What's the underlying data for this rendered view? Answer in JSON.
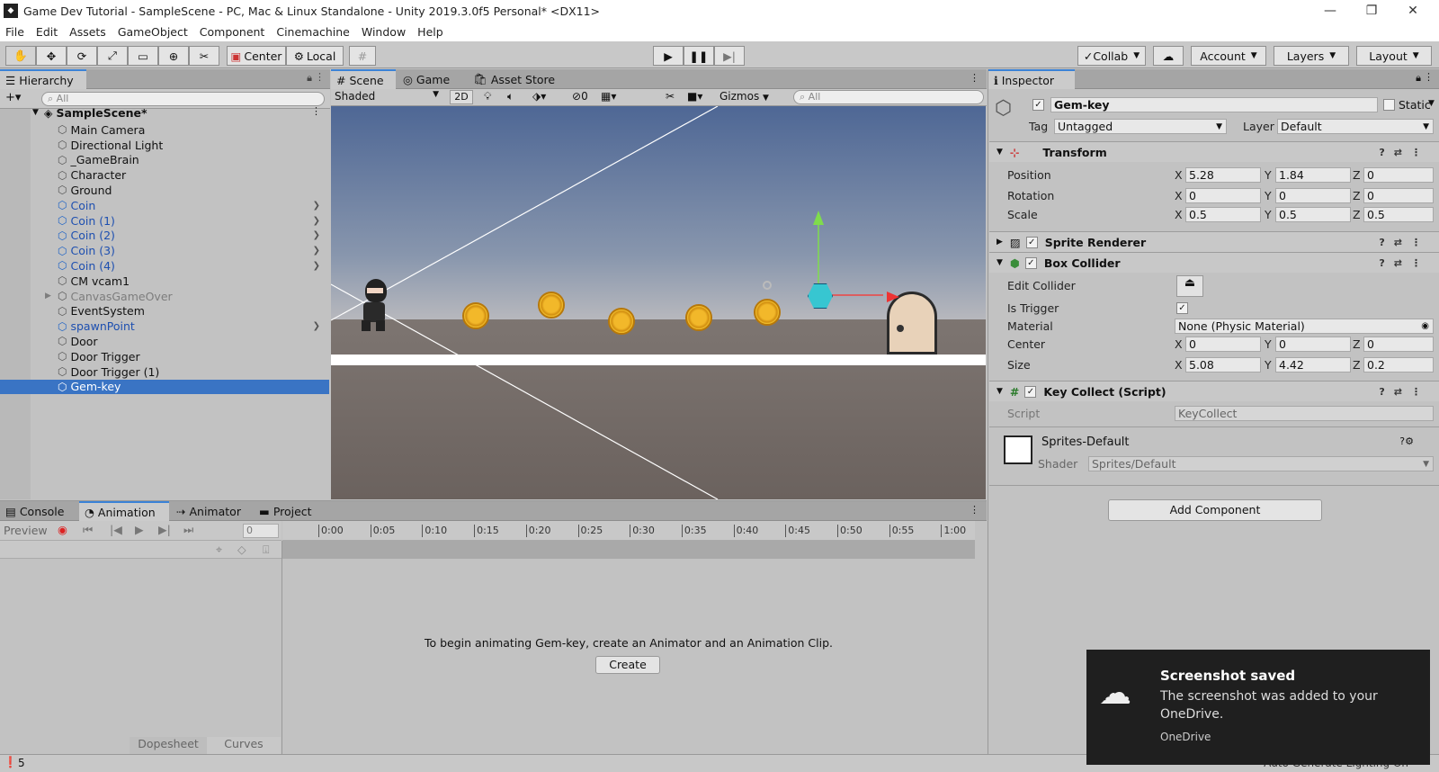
{
  "window": {
    "title": "Game Dev Tutorial - SampleScene - PC, Mac & Linux Standalone - Unity 2019.3.0f5 Personal* <DX11>"
  },
  "menu": [
    "File",
    "Edit",
    "Assets",
    "GameObject",
    "Component",
    "Cinemachine",
    "Window",
    "Help"
  ],
  "toolbar": {
    "center": "Center",
    "local": "Local",
    "collab": "Collab",
    "account": "Account",
    "layers": "Layers",
    "layout": "Layout"
  },
  "hierarchy": {
    "tab": "Hierarchy",
    "search_placeholder": "All",
    "scene": "SampleScene*",
    "items": [
      {
        "label": "Main Camera",
        "kind": "normal"
      },
      {
        "label": "Directional Light",
        "kind": "normal"
      },
      {
        "label": "_GameBrain",
        "kind": "normal"
      },
      {
        "label": "Character",
        "kind": "normal"
      },
      {
        "label": "Ground",
        "kind": "normal"
      },
      {
        "label": "Coin",
        "kind": "prefab"
      },
      {
        "label": "Coin (1)",
        "kind": "prefab"
      },
      {
        "label": "Coin (2)",
        "kind": "prefab"
      },
      {
        "label": "Coin (3)",
        "kind": "prefab"
      },
      {
        "label": "Coin (4)",
        "kind": "prefab"
      },
      {
        "label": "CM vcam1",
        "kind": "normal"
      },
      {
        "label": "CanvasGameOver",
        "kind": "disabled"
      },
      {
        "label": "EventSystem",
        "kind": "normal"
      },
      {
        "label": "spawnPoint",
        "kind": "prefab"
      },
      {
        "label": "Door",
        "kind": "normal"
      },
      {
        "label": "Door Trigger",
        "kind": "normal"
      },
      {
        "label": "Door Trigger (1)",
        "kind": "normal"
      },
      {
        "label": "Gem-key",
        "kind": "selected"
      }
    ]
  },
  "scene": {
    "tabs": [
      "Scene",
      "Game",
      "Asset Store"
    ],
    "shading": "Shaded",
    "mode2d": "2D",
    "hidden_count": "0",
    "gizmos": "Gizmos",
    "search_placeholder": "All"
  },
  "inspector": {
    "tab": "Inspector",
    "object_name": "Gem-key",
    "static_label": "Static",
    "tag_label": "Tag",
    "tag_value": "Untagged",
    "layer_label": "Layer",
    "layer_value": "Default",
    "transform": {
      "title": "Transform",
      "position_label": "Position",
      "position": {
        "x": "5.28",
        "y": "1.84",
        "z": "0"
      },
      "rotation_label": "Rotation",
      "rotation": {
        "x": "0",
        "y": "0",
        "z": "0"
      },
      "scale_label": "Scale",
      "scale": {
        "x": "0.5",
        "y": "0.5",
        "z": "0.5"
      }
    },
    "sprite_renderer": "Sprite Renderer",
    "box_collider": {
      "title": "Box Collider",
      "edit_collider": "Edit Collider",
      "is_trigger": "Is Trigger",
      "material_label": "Material",
      "material_value": "None (Physic Material)",
      "center_label": "Center",
      "center": {
        "x": "0",
        "y": "0",
        "z": "0"
      },
      "size_label": "Size",
      "size": {
        "x": "5.08",
        "y": "4.42",
        "z": "0.2"
      }
    },
    "key_collect": {
      "title": "Key Collect (Script)",
      "script_label": "Script",
      "script_value": "KeyCollect"
    },
    "material": {
      "name": "Sprites-Default",
      "shader_label": "Shader",
      "shader_value": "Sprites/Default"
    },
    "add_component": "Add Component"
  },
  "animation": {
    "tabs": [
      "Console",
      "Animation",
      "Animator",
      "Project"
    ],
    "preview": "Preview",
    "frame": "0",
    "timeline": [
      "0:00",
      "0:05",
      "0:10",
      "0:15",
      "0:20",
      "0:25",
      "0:30",
      "0:35",
      "0:40",
      "0:45",
      "0:50",
      "0:55",
      "1:00"
    ],
    "message": "To begin animating Gem-key, create an Animator and an Animation Clip.",
    "create": "Create",
    "dopesheet": "Dopesheet",
    "curves": "Curves"
  },
  "status": {
    "count": "5",
    "lighting": "Auto Generate Lighting On"
  },
  "toast": {
    "title": "Screenshot saved",
    "body": "The screenshot was added to your OneDrive.",
    "source": "OneDrive"
  }
}
